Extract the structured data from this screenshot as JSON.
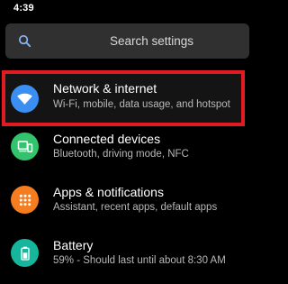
{
  "status_bar": {
    "time": "4:39"
  },
  "search": {
    "placeholder": "Search settings",
    "icon": "search-icon"
  },
  "items": [
    {
      "title": "Network & internet",
      "summary": "Wi-Fi, mobile, data usage, and hotspot",
      "icon": "wifi-icon",
      "color": "#3b8ef2",
      "highlighted": true
    },
    {
      "title": "Connected devices",
      "summary": "Bluetooth, driving mode, NFC",
      "icon": "connected-devices-icon",
      "color": "#32c36c"
    },
    {
      "title": "Apps & notifications",
      "summary": "Assistant, recent apps, default apps",
      "icon": "apps-grid-icon",
      "color": "#f57c1f"
    },
    {
      "title": "Battery",
      "summary": "59% - Should last until about 8:30 AM",
      "icon": "battery-icon",
      "color": "#16b69c"
    }
  ],
  "colors": {
    "background": "#000000",
    "highlight_border": "#e11b22",
    "search_bg": "#303030"
  }
}
